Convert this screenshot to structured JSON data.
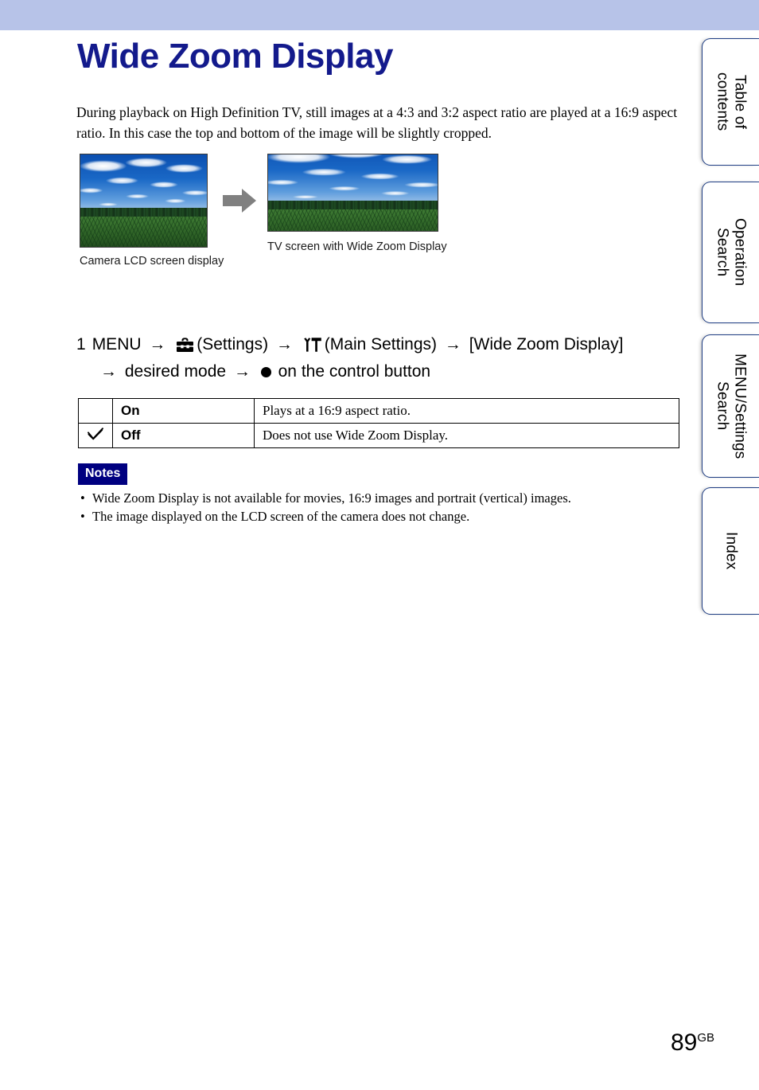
{
  "header": {
    "band_color": "#b7c3e8"
  },
  "document": {
    "title": "Wide Zoom Display",
    "title_color": "#131a8c",
    "intro": "During playback on High Definition TV, still images at a 4:3 and 3:2 aspect ratio are played at a 16:9 aspect ratio. In this case the top and bottom of the image will be slightly cropped."
  },
  "figures": [
    {
      "caption": "Camera LCD screen display",
      "aspect": "4:3",
      "alt": "Camera LCD screen showing a cornfield under a blue sky with clouds"
    },
    {
      "caption": "TV screen with Wide Zoom Display",
      "aspect": "16:9",
      "alt": "TV screen showing the same cornfield cropped to a 16:9 wide view"
    }
  ],
  "arrow": {
    "icon": "right-arrow-icon",
    "color": "#808080"
  },
  "step": {
    "number": "1",
    "menu_label": "MENU",
    "settings_icon": "toolbox-icon",
    "settings_label": "(Settings)",
    "main_settings_icon": "wrench-hammer-icon",
    "main_settings_label": "(Main Settings)",
    "target_label": "[Wide Zoom Display]",
    "desired_mode_label": "desired mode",
    "control_button_label": "on the control button",
    "arrow_glyph": "→"
  },
  "options_table": {
    "rows": [
      {
        "selected": false,
        "check_glyph": "",
        "name": "On",
        "description": "Plays at a 16:9 aspect ratio."
      },
      {
        "selected": true,
        "check_glyph": "✓",
        "name": "Off",
        "description": "Does not use Wide Zoom Display."
      }
    ]
  },
  "notes": {
    "badge_label": "Notes",
    "badge_color": "#000080",
    "items": [
      "Wide Zoom Display is not available for movies, 16:9 images and portrait (vertical) images.",
      "The image displayed on the LCD screen of the camera does not change."
    ]
  },
  "page_footer": {
    "number": "89",
    "region": "GB"
  },
  "side_tabs": [
    {
      "label": "Table of\ncontents"
    },
    {
      "label": "Operation\nSearch"
    },
    {
      "label": "MENU/Settings\nSearch"
    },
    {
      "label": "Index"
    }
  ]
}
